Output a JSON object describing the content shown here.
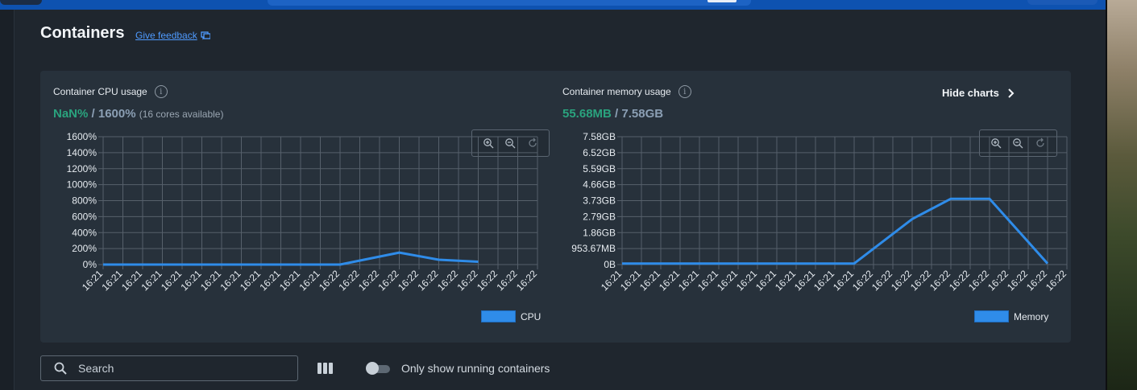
{
  "page": {
    "title": "Containers",
    "feedback_label": "Give feedback",
    "hide_charts_label": "Hide charts"
  },
  "cpu_panel": {
    "label": "Container CPU usage",
    "value_current": "NaN%",
    "value_sep_total": " / 1600%",
    "value_note": "(16 cores available)",
    "legend": "CPU"
  },
  "memory_panel": {
    "label": "Container memory usage",
    "value_current": "55.68MB",
    "value_sep_total": " / 7.58GB",
    "legend": "Memory"
  },
  "toolbar": {
    "search_placeholder": "Search",
    "running_toggle_label": "Only show running containers"
  },
  "colors": {
    "accent": "#2f8ce9",
    "green_value": "#2aa37e",
    "link": "#4f9bff",
    "topbar": "#0e52b0"
  },
  "icons": [
    "feedback-icon",
    "info-icon",
    "chevron-right-icon",
    "zoom-in-icon",
    "zoom-out-icon",
    "reset-zoom-icon",
    "search-icon",
    "columns-icon"
  ],
  "chart_data": [
    {
      "type": "line",
      "title": "Container CPU usage",
      "x": [
        "16:21",
        "16:21",
        "16:21",
        "16:21",
        "16:21",
        "16:21",
        "16:21",
        "16:21",
        "16:21",
        "16:21",
        "16:21",
        "16:21",
        "16:22",
        "16:22",
        "16:22",
        "16:22",
        "16:22",
        "16:22",
        "16:22",
        "16:22",
        "16:22",
        "16:22",
        "16:22"
      ],
      "yticks": [
        "0%",
        "200%",
        "400%",
        "600%",
        "800%",
        "1000%",
        "1200%",
        "1400%",
        "1600%"
      ],
      "ylim": [
        0,
        1600
      ],
      "series": [
        {
          "name": "CPU",
          "values": [
            0,
            0,
            0,
            0,
            0,
            0,
            0,
            0,
            0,
            0,
            0,
            0,
            0,
            null,
            null,
            150,
            null,
            60,
            null,
            35,
            null,
            null,
            null
          ]
        }
      ],
      "grid": true,
      "legend_position": "bottom-right"
    },
    {
      "type": "line",
      "title": "Container memory usage",
      "x": [
        "16:21",
        "16:21",
        "16:21",
        "16:21",
        "16:21",
        "16:21",
        "16:21",
        "16:21",
        "16:21",
        "16:21",
        "16:21",
        "16:21",
        "16:21",
        "16:22",
        "16:22",
        "16:22",
        "16:22",
        "16:22",
        "16:22",
        "16:22",
        "16:22",
        "16:22",
        "16:22",
        "16:22"
      ],
      "yticks": [
        "0B",
        "953.67MB",
        "1.86GB",
        "2.79GB",
        "3.73GB",
        "4.66GB",
        "5.59GB",
        "6.52GB",
        "7.58GB"
      ],
      "ylim": [
        0,
        7.58
      ],
      "series": [
        {
          "name": "Memory",
          "values": [
            0.06,
            0.06,
            0.06,
            0.06,
            0.06,
            0.06,
            0.06,
            0.06,
            0.06,
            0.06,
            0.06,
            0.06,
            0.06,
            null,
            null,
            2.7,
            null,
            3.9,
            null,
            3.9,
            null,
            null,
            0.06,
            null
          ]
        }
      ],
      "grid": true,
      "legend_position": "bottom-right"
    }
  ]
}
